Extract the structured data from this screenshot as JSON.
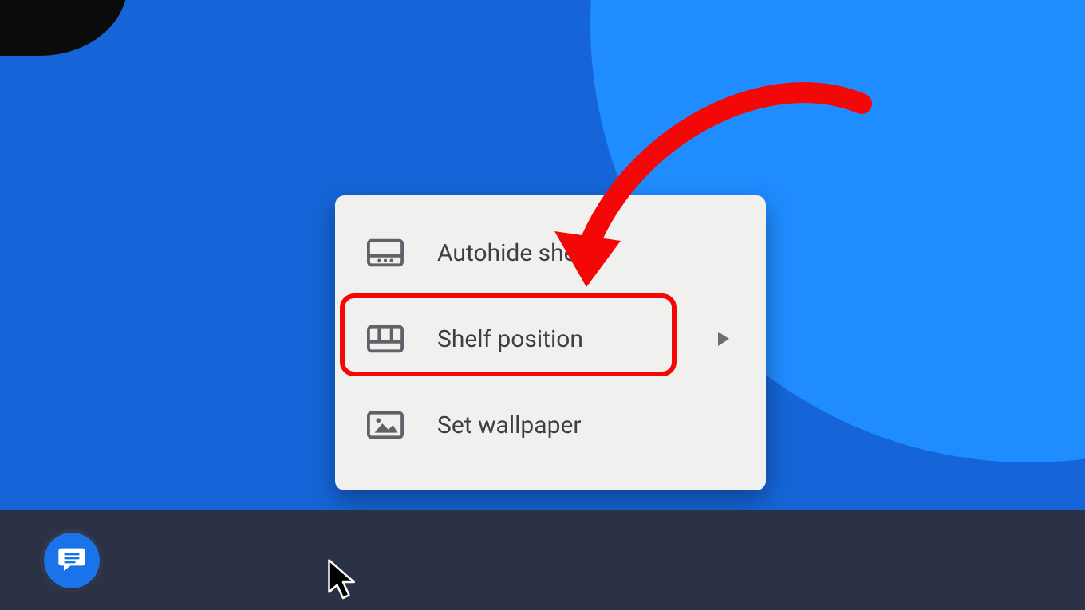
{
  "annotation": {
    "highlighted_item": "menu.items.1",
    "arrow_color": "#f30707",
    "highlight_color": "#f30707"
  },
  "menu": {
    "items": [
      {
        "id": "autohide-shelf",
        "icon": "dock-bottom-dots-icon",
        "label": "Autohide shelf",
        "has_submenu": false
      },
      {
        "id": "shelf-position",
        "icon": "dock-bottom-columns-icon",
        "label": "Shelf position",
        "has_submenu": true
      },
      {
        "id": "set-wallpaper",
        "icon": "picture-icon",
        "label": "Set wallpaper",
        "has_submenu": false
      }
    ]
  },
  "shelf": {
    "apps": [
      {
        "id": "messages",
        "icon": "chat-bubble-icon",
        "color": "#1a73e8"
      }
    ]
  }
}
